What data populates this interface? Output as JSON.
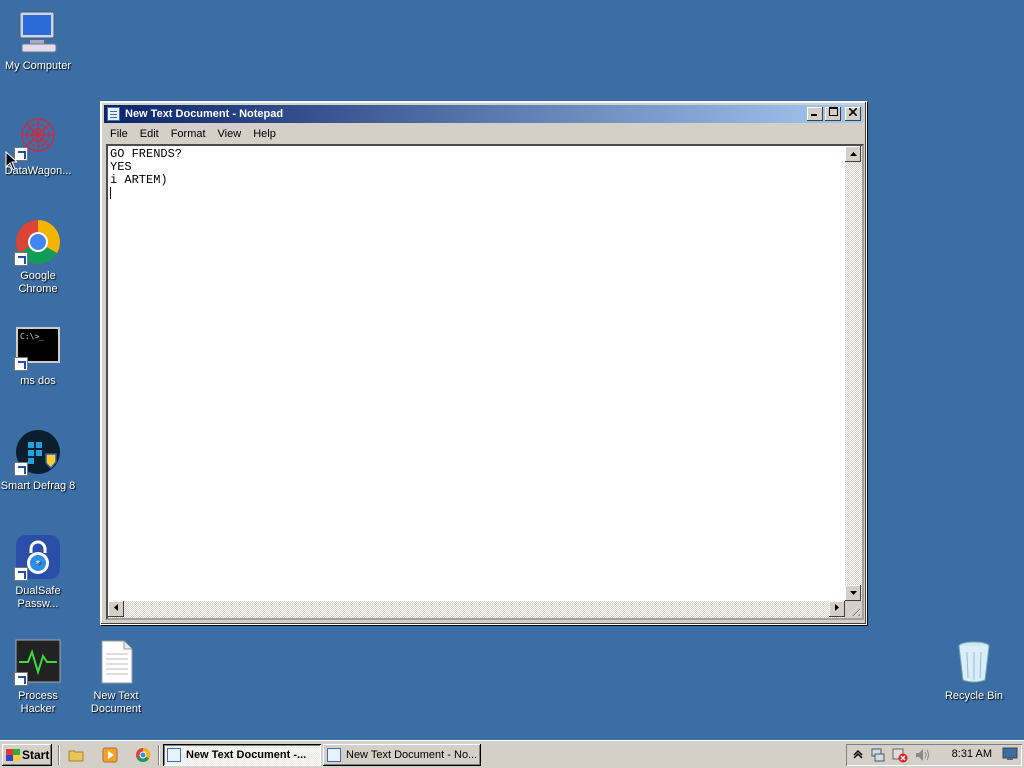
{
  "desktop": {
    "icons": [
      {
        "label": "My Computer"
      },
      {
        "label": "DataWagon..."
      },
      {
        "label": "Google Chrome"
      },
      {
        "label": "ms dos"
      },
      {
        "label": "Smart Defrag 8"
      },
      {
        "label": "DualSafe Passw..."
      },
      {
        "label": "Process Hacker"
      },
      {
        "label": "New Text Document"
      },
      {
        "label": "Recycle Bin"
      }
    ]
  },
  "notepad": {
    "title": "New Text Document - Notepad",
    "menu": [
      "File",
      "Edit",
      "Format",
      "View",
      "Help"
    ],
    "content": "GO FRENDS?\nYES\ni ARTEM)\n"
  },
  "taskbar": {
    "start_label": "Start",
    "tasks": [
      {
        "label": "New Text Document -...",
        "active": true
      },
      {
        "label": "New Text Document - No...",
        "active": false
      }
    ],
    "clock": "8:31 AM"
  },
  "colors": {
    "desktop": "#3a6ea5",
    "titlebar_start": "#0a246a",
    "titlebar_end": "#a6caf0",
    "chrome": "#d4d0c8"
  }
}
